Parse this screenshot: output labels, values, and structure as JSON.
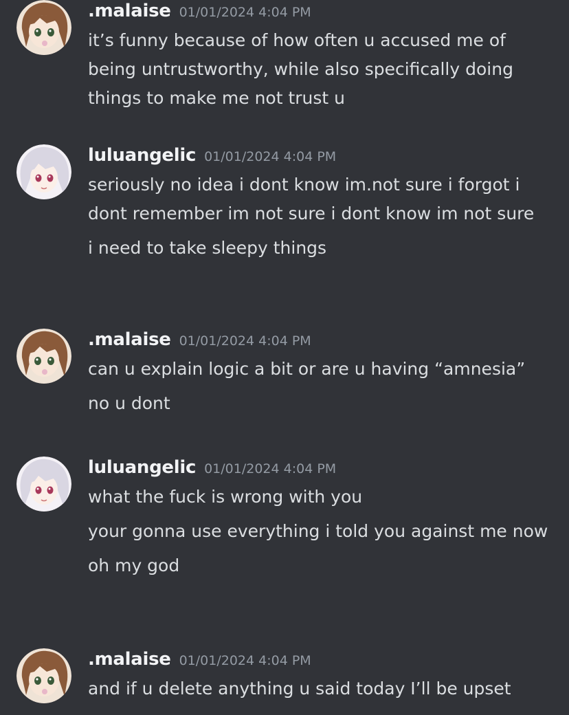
{
  "messages": [
    {
      "username": ".malaise",
      "avatar": "brown-haired-anime-girl-avatar",
      "timestamp": "01/01/2024 4:04 PM",
      "lines": [
        "it’s funny because of how often u accused me of being untrustworthy, while also specifically doing things to make me not trust u"
      ]
    },
    {
      "username": "luluangelic",
      "avatar": "white-haired-anime-girl-avatar",
      "timestamp": "01/01/2024 4:04 PM",
      "lines": [
        "seriously no idea i dont know im.not sure i forgot i dont remember im not sure i dont know im not sure",
        "i need to take sleepy things"
      ]
    },
    {
      "username": ".malaise",
      "avatar": "brown-haired-anime-girl-avatar",
      "timestamp": "01/01/2024 4:04 PM",
      "lines": [
        "can u explain logic a bit or are u having “amnesia”",
        "no u dont"
      ]
    },
    {
      "username": "luluangelic",
      "avatar": "white-haired-anime-girl-avatar",
      "timestamp": "01/01/2024 4:04 PM",
      "lines": [
        "what the fuck is wrong with you",
        "your gonna use everything i told you against me now",
        "oh my god"
      ]
    },
    {
      "username": ".malaise",
      "avatar": "brown-haired-anime-girl-avatar",
      "timestamp": "01/01/2024 4:04 PM",
      "lines": [
        "and if u delete anything u said today I’ll be upset"
      ]
    }
  ],
  "colors": {
    "background": "#313338",
    "username": "#f2f3f5",
    "timestamp": "#949ba4",
    "message_text": "#dbdee1"
  }
}
